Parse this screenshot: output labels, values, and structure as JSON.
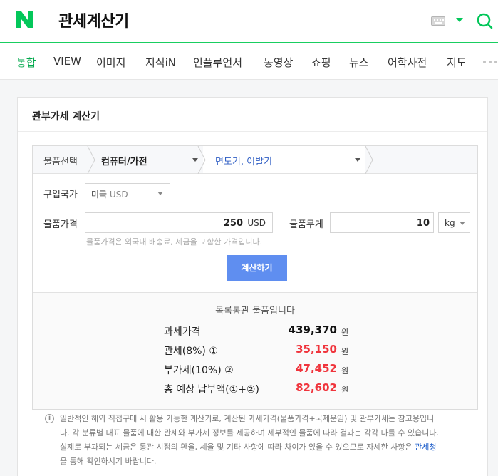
{
  "header": {
    "query": "관세계산기",
    "brand_color": "#03c75a"
  },
  "tabs": [
    "통합",
    "VIEW",
    "이미지",
    "지식iN",
    "인플루언서",
    "동영상",
    "쇼핑",
    "뉴스",
    "어학사전",
    "지도"
  ],
  "card": {
    "title": "관부가세 계산기",
    "category": {
      "label": "물품선택",
      "level1": "컴퓨터/가전",
      "level2": "면도기, 이발기"
    },
    "country": {
      "label": "구입국가",
      "value": "미국",
      "currency": "USD"
    },
    "price": {
      "label": "물품가격",
      "value": "250",
      "unit": "USD",
      "hint": "물품가격은 외국내 배송료, 세금을 포함한 가격입니다."
    },
    "weight": {
      "label": "물품무게",
      "value": "10",
      "unit": "kg"
    },
    "calc_button": "계산하기",
    "result": {
      "headline": "목록통관 물품입니다",
      "rows": [
        {
          "label": "과세가격",
          "value": "439,370",
          "unit": "원"
        },
        {
          "label": "관세(8%) ①",
          "value": "35,150",
          "unit": "원"
        },
        {
          "label": "부가세(10%) ②",
          "value": "47,452",
          "unit": "원"
        },
        {
          "label": "총 예상 납부액(①+②)",
          "value": "82,602",
          "unit": "원"
        }
      ]
    }
  },
  "notice": {
    "icon": "i",
    "line1": "일반적인 해외 직접구매 시 활용 가능한 계산기로, 계산된 과세가격(물품가격+국제운임) 및 관부가세는 참고용입니",
    "line2": "다. 각 분류별 대표 물품에 대한 관세와 부가세 정보를 제공하며 세부적인 물품에 따라 결과는 각각 다를 수 있습니다.",
    "line3": "실제로 부과되는 세금은 통관 시점의 환율, 세율 및 기타 사항에 따라 차이가 있을 수 있으므로 자세한 사항은 ",
    "link": "관세청",
    "line4": "을 통해 확인하시기 바랍니다."
  }
}
